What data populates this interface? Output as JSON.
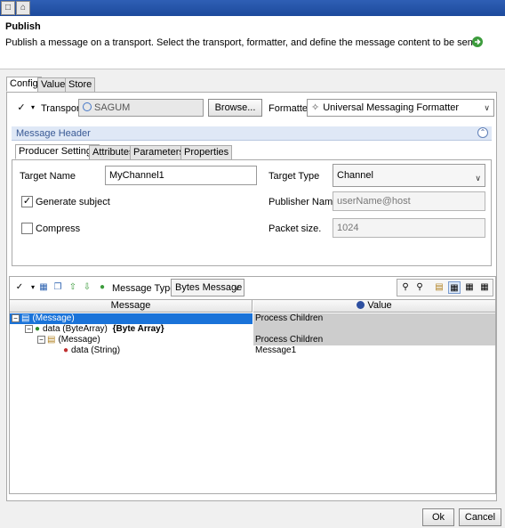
{
  "header": {
    "title": "Publish",
    "description": "Publish a message on a transport. Select the transport, formatter, and define the message content to be sent."
  },
  "tabs": [
    "Config",
    "Value",
    "Store"
  ],
  "transport": {
    "label": "Transport",
    "value": "SAGUM",
    "browse_label": "Browse...",
    "formatter_label": "Formatter",
    "formatter_value": "Universal Messaging Formatter"
  },
  "message_header": {
    "title": "Message Header",
    "tabs": [
      "Producer Settings",
      "Attributes",
      "Parameters",
      "Properties"
    ],
    "target_name_label": "Target Name",
    "target_name_value": "MyChannel1",
    "target_type_label": "Target Type",
    "target_type_value": "Channel",
    "generate_subject_label": "Generate subject",
    "generate_subject_checked": true,
    "publisher_name_label": "Publisher Name",
    "publisher_name_placeholder": "userName@host",
    "compress_label": "Compress",
    "compress_checked": false,
    "packet_size_label": "Packet size.",
    "packet_size_value": "1024"
  },
  "message_toolbar": {
    "message_type_label": "Message Type",
    "message_type_value": "Bytes Message"
  },
  "grid": {
    "col_message": "Message",
    "col_value": "Value",
    "rows": [
      {
        "message": "(Message)",
        "type": "",
        "value": "Process Children"
      },
      {
        "message": "data (ByteArray)",
        "type": "{Byte Array}",
        "value": ""
      },
      {
        "message": "(Message)",
        "type": "",
        "value": "Process Children"
      },
      {
        "message": "data (String)",
        "type": "",
        "value": "Message1"
      }
    ]
  },
  "footer": {
    "ok_label": "Ok",
    "cancel_label": "Cancel"
  },
  "colors": {
    "selection": "#1a73d9",
    "section_text": "#3a5a95",
    "section_bg": "#dfe8f6"
  }
}
